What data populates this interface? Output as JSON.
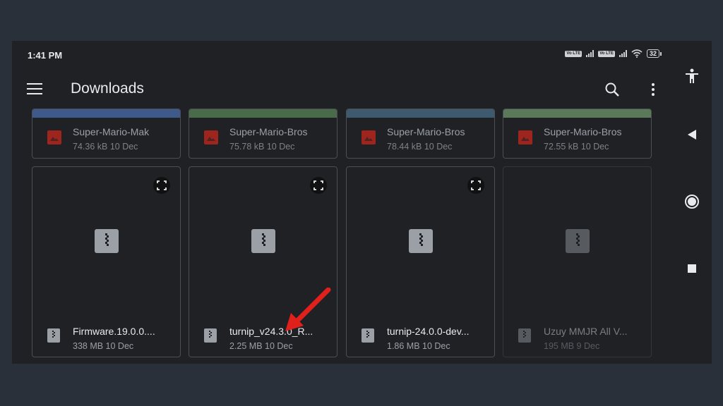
{
  "status_bar": {
    "time": "1:41 PM",
    "volte_1": "Vo LTE",
    "volte_2": "Vo LTE",
    "battery": "32"
  },
  "toolbar": {
    "title": "Downloads",
    "menu_icon": "hamburger-menu-icon",
    "search_icon": "search-icon",
    "more_icon": "more-vertical-icon"
  },
  "files_top": [
    {
      "name": "Super-Mario-Mak",
      "meta": "74.36 kB 10 Dec",
      "thumb_color": "#3d5a8a"
    },
    {
      "name": "Super-Mario-Bros",
      "meta": "75.78 kB 10 Dec",
      "thumb_color": "#4a6b4a"
    },
    {
      "name": "Super-Mario-Bros",
      "meta": "78.44 kB 10 Dec",
      "thumb_color": "#3d5a6e"
    },
    {
      "name": "Super-Mario-Bros",
      "meta": "72.55 kB 10 Dec",
      "thumb_color": "#5a7a5a"
    }
  ],
  "files": [
    {
      "name": "Firmware.19.0.0....",
      "meta": "338 MB 10 Dec"
    },
    {
      "name": "turnip_v24.3.0_R...",
      "meta": "2.25 MB 10 Dec"
    },
    {
      "name": "turnip-24.0.0-dev...",
      "meta": "1.86 MB 10 Dec"
    },
    {
      "name": "Uzuy MMJR All V...",
      "meta": "195 MB 9 Dec"
    }
  ],
  "colors": {
    "background": "#202124",
    "card_border": "#4b4e52",
    "arrow": "#e0201b",
    "image_icon": "#b3261e"
  },
  "nav": {
    "accessibility_icon": "accessibility-icon",
    "back_icon": "back-triangle-icon",
    "home_icon": "home-circle-icon",
    "recents_icon": "recents-square-icon"
  }
}
